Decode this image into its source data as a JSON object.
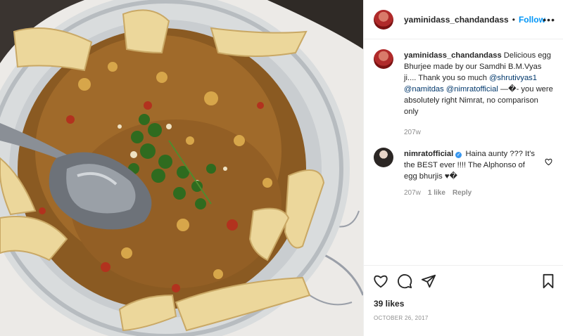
{
  "post": {
    "author": {
      "username": "yaminidass_chandandass",
      "follow_label": "Follow",
      "separator": "•"
    },
    "caption": {
      "username": "yaminidass_chandandass",
      "text_1": "Delicious egg Bhurjee made by our Samdhi B.M.Vyas ji.... Thank you so much",
      "mention_1": "@shrutivyas1",
      "mention_2": "@namitdas",
      "mention_3": "@nimratofficial",
      "text_2": "—�- you were absolutely right Nimrat, no comparison only",
      "age": "207w"
    },
    "comments": [
      {
        "username": "nimratofficial",
        "verified": true,
        "text": "Haina aunty ??? It's the BEST ever !!!! The Alphonso of egg bhurjis ♥�",
        "age": "207w",
        "likes_label": "1 like",
        "reply_label": "Reply"
      }
    ],
    "likes_label": "39 likes",
    "date_label": "OCTOBER 26, 2017"
  },
  "icons": {
    "like": "heart-outline-icon",
    "comment": "speech-bubble-icon",
    "share": "paper-plane-icon",
    "save": "bookmark-icon",
    "more": "more-horizontal-icon"
  },
  "colors": {
    "accent": "#0095f6",
    "mention": "#00376b",
    "muted": "#8e8e8e",
    "text": "#262626"
  }
}
